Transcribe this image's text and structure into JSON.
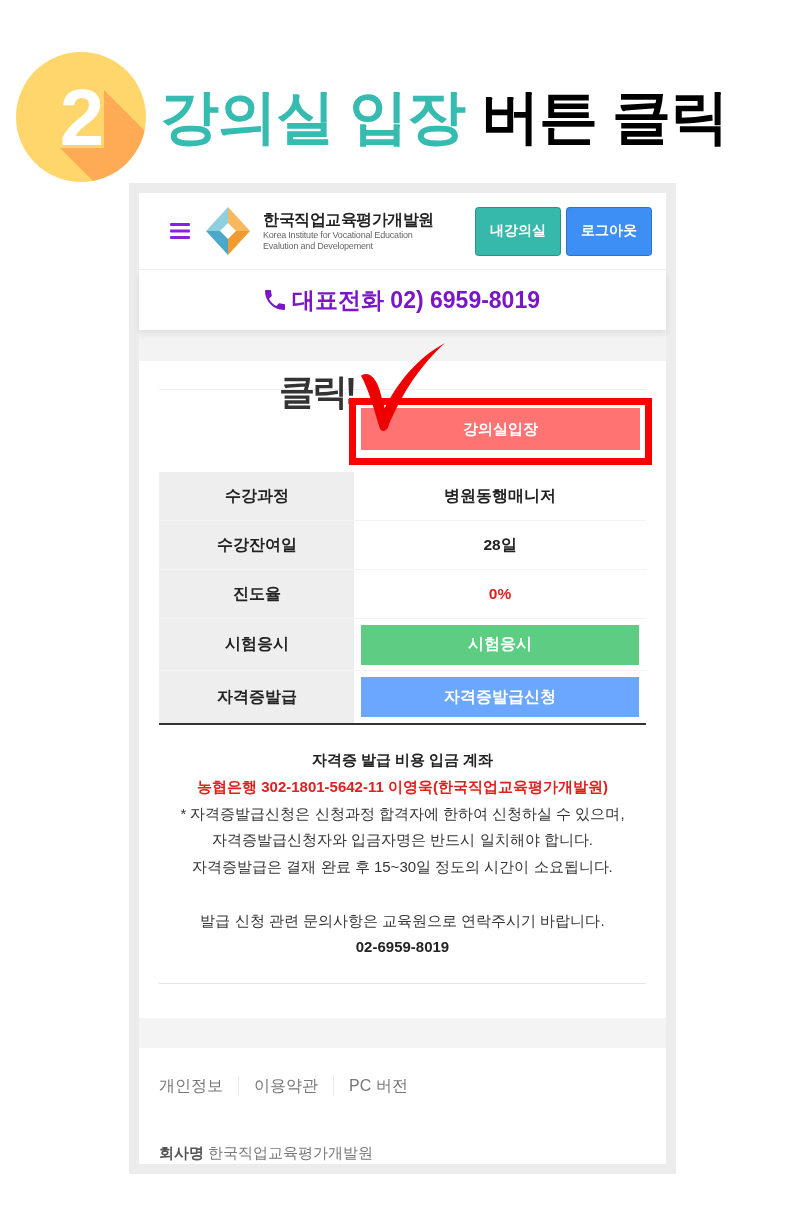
{
  "heading": {
    "step": "2",
    "title_accent": "강의실 입장",
    "title_rest": "버튼 클릭"
  },
  "header": {
    "org_name": "한국직업교육평가개발원",
    "org_subtitle": [
      "Korea Institute for Vocational Education",
      "Evalution and Developement"
    ],
    "buttons": [
      {
        "label": "내강의실",
        "color": "#36b9ab"
      },
      {
        "label": "로그아웃",
        "color": "#3d8ff5"
      }
    ]
  },
  "phone_bar": {
    "text": "대표전화 02) 6959-8019"
  },
  "annotation": {
    "label": "클릭!"
  },
  "enter_button": {
    "label": "강의실입장",
    "highlighted": true
  },
  "table": {
    "rows": [
      {
        "label": "수강과정",
        "kind": "text",
        "value": "병원동행매니저"
      },
      {
        "label": "수강잔여일",
        "kind": "text",
        "value": "28일"
      },
      {
        "label": "진도율",
        "kind": "alert",
        "value": "0%"
      },
      {
        "label": "시험응시",
        "kind": "button",
        "value": "시험응시",
        "color": "#5ccd83"
      },
      {
        "label": "자격증발급",
        "kind": "button",
        "value": "자격증발급신청",
        "color": "#6ba7ff"
      }
    ]
  },
  "notice": {
    "title": "자격증 발급 비용 입금 계좌",
    "account": "농협은행 302-1801-5642-11 이영욱(한국직업교육평가개발원)",
    "lines": [
      "* 자격증발급신청은 신청과정 합격자에 한하여 신청하실 수 있으며,",
      "자격증발급신청자와 입금자명은 반드시 일치해야 합니다.",
      "자격증발급은 결재 완료 후 15~30일 정도의 시간이 소요됩니다."
    ],
    "contact": "발급 신청 관련 문의사항은 교육원으로 연락주시기 바랍니다.",
    "phone": "02-6959-8019"
  },
  "footer": {
    "links": [
      "개인정보",
      "이용약관",
      "PC 버전"
    ],
    "company": "**회사명** 한국직업교육평가개발원"
  }
}
